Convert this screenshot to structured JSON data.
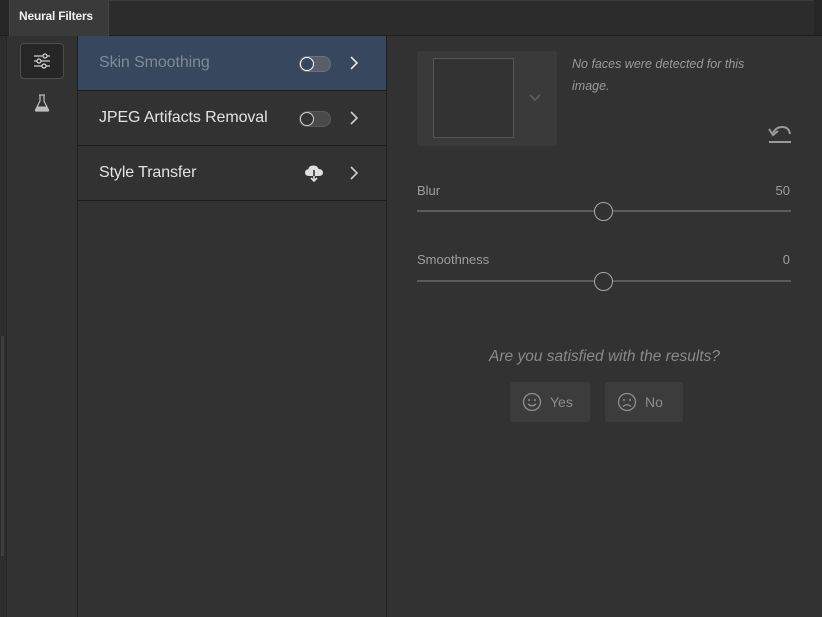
{
  "app": {
    "tab_title": "Neural Filters"
  },
  "sidebar": {
    "items": [
      {
        "name": "sliders-icon",
        "active": true
      },
      {
        "name": "flask-icon",
        "active": false
      }
    ]
  },
  "filters": [
    {
      "label": "Skin Smoothing",
      "control": "toggle",
      "enabled": false,
      "selected": true
    },
    {
      "label": "JPEG Artifacts Removal",
      "control": "toggle",
      "enabled": false,
      "selected": false
    },
    {
      "label": "Style Transfer",
      "control": "cloud-download-icon",
      "selected": false
    }
  ],
  "panel": {
    "no_faces_message": "No faces were detected for this image.",
    "sliders": [
      {
        "label": "Blur",
        "value": "50",
        "min": 0,
        "max": 100,
        "current": 50
      },
      {
        "label": "Smoothness",
        "value": "0",
        "min": -50,
        "max": 50,
        "current": 0
      }
    ],
    "feedback": {
      "question": "Are you satisfied with the results?",
      "yes_label": "Yes",
      "no_label": "No"
    }
  },
  "colors": {
    "background": "#323232",
    "selected_row": "#37475e",
    "tab_bg": "#3a3a3a"
  }
}
